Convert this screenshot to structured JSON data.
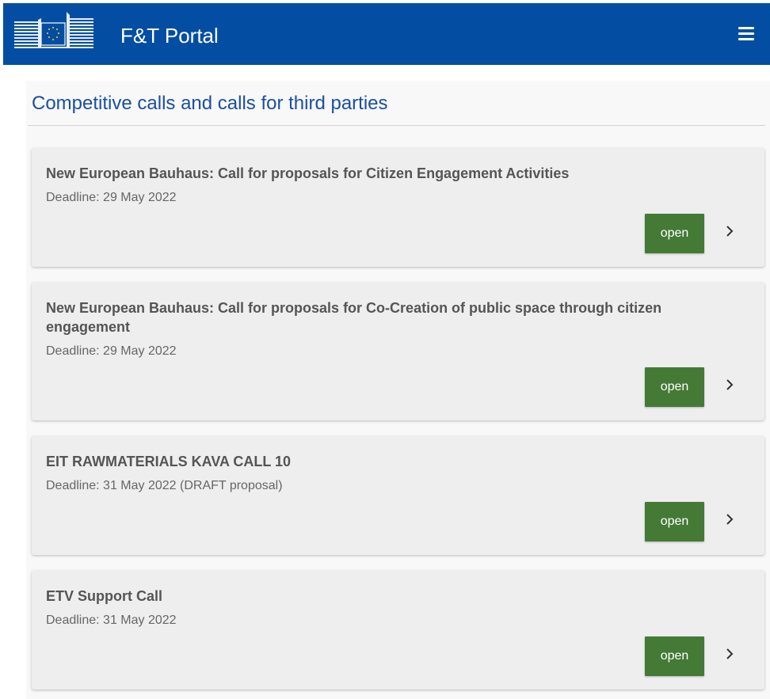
{
  "header": {
    "app_title": "F&T Portal",
    "bg_color": "#034ea2",
    "menu_icon": "hamburger-menu-icon",
    "logo_icon": "european-commission-logo"
  },
  "page": {
    "title": "Competitive calls and calls for third parties"
  },
  "calls": [
    {
      "title": "New European Bauhaus: Call for proposals for Citizen Engagement Activities",
      "deadline": "Deadline: 29 May 2022",
      "status": "open"
    },
    {
      "title": "New European Bauhaus: Call for proposals for Co-Creation of public space through citizen engagement",
      "deadline": "Deadline: 29 May 2022",
      "status": "open"
    },
    {
      "title": "EIT RAWMATERIALS KAVA CALL 10",
      "deadline": "Deadline: 31 May 2022 (DRAFT proposal)",
      "status": "open"
    },
    {
      "title": "ETV Support Call",
      "deadline": "Deadline: 31 May 2022",
      "status": "open"
    }
  ],
  "colors": {
    "open_button": "#447a35",
    "title_blue": "#1b4fa0",
    "card_bg": "#eeeeee"
  }
}
